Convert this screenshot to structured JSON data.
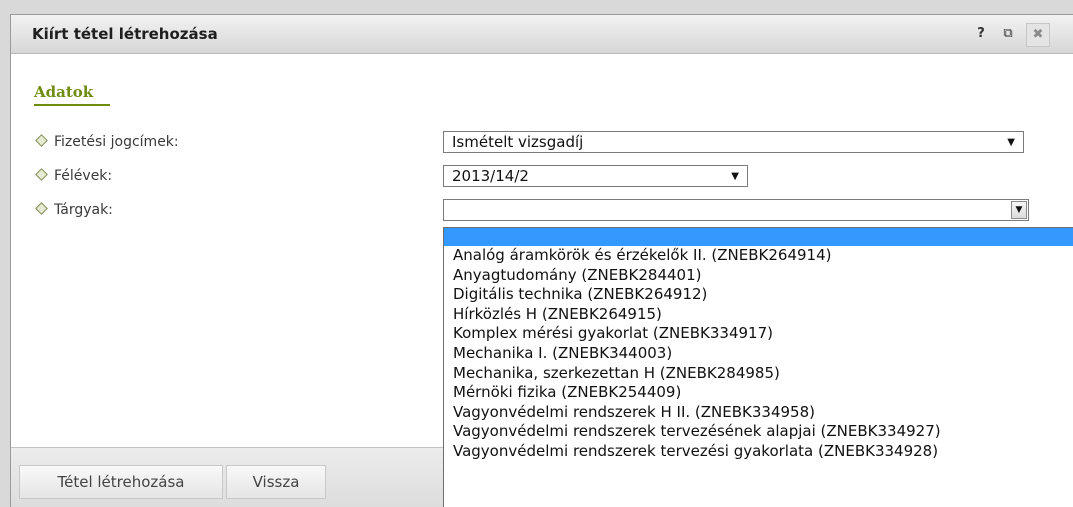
{
  "dialog": {
    "title": "Kiírt tétel létrehozása",
    "help_icon": "?",
    "popout_icon": "⧉",
    "close_icon": "✖"
  },
  "section": {
    "title": "Adatok"
  },
  "fields": {
    "payment": {
      "label": "Fizetési jogcímek:",
      "value": "Ismételt vizsgadíj"
    },
    "semester": {
      "label": "Félévek:",
      "value": "2013/14/2"
    },
    "subjects": {
      "label": "Tárgyak:",
      "value": ""
    }
  },
  "dropdown": {
    "options": [
      "",
      "Analóg áramkörök és érzékelők II. (ZNEBK264914)",
      "Anyagtudomány (ZNEBK284401)",
      "Digitális technika (ZNEBK264912)",
      "Hírközlés H (ZNEBK264915)",
      "Komplex mérési gyakorlat (ZNEBK334917)",
      "Mechanika I. (ZNEBK344003)",
      "Mechanika, szerkezettan H (ZNEBK284985)",
      "Mérnöki fizika (ZNEBK254409)",
      "Vagyonvédelmi rendszerek H II. (ZNEBK334958)",
      "Vagyonvédelmi rendszerek tervezésének alapjai (ZNEBK334927)",
      "Vagyonvédelmi rendszerek tervezési gyakorlata (ZNEBK334928)"
    ],
    "highlight_color": "#3399ff"
  },
  "buttons": {
    "create": "Tétel létrehozása",
    "back": "Vissza"
  },
  "colors": {
    "section_accent": "#6e8c10"
  }
}
